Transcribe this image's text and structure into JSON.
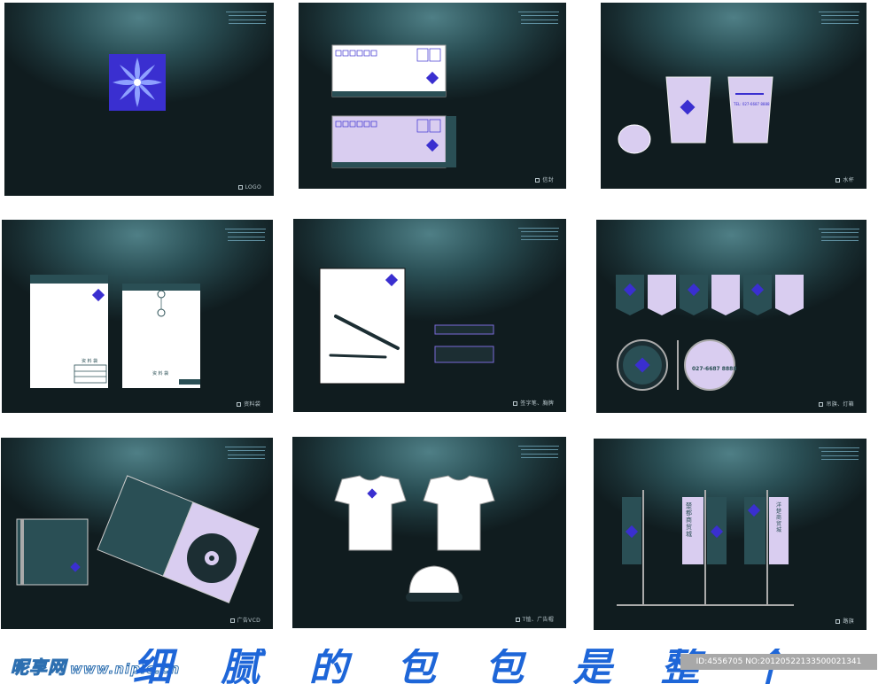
{
  "panels": [
    {
      "caption": "LOGO"
    },
    {
      "caption": "信封"
    },
    {
      "caption": "水杯"
    },
    {
      "caption": "资料袋"
    },
    {
      "caption": "签字笔、胸牌"
    },
    {
      "caption": "吊旗、灯箱"
    },
    {
      "caption": "广告VCD"
    },
    {
      "caption": "T恤、广告帽"
    },
    {
      "caption": "路旗"
    }
  ],
  "items": {
    "folder_label": "资 料 袋",
    "phone": "027-6687 8888",
    "tel_line": "TEL: 027-6687 8888",
    "banner_name": "楚都商贸城",
    "banner_name2": "洋楚商贸城"
  },
  "footer": {
    "site": "昵享网",
    "url": "www.nipic.cn",
    "slogan": "细 腻 的 包 包 是 整 个",
    "image_id": "ID:4556705 NO:20120522133500021341"
  },
  "colors": {
    "accent": "#3a2fd0",
    "lilac": "#d9cdf0",
    "panel_dark": "#182c30",
    "watermark_blue": "#1e66d8"
  }
}
